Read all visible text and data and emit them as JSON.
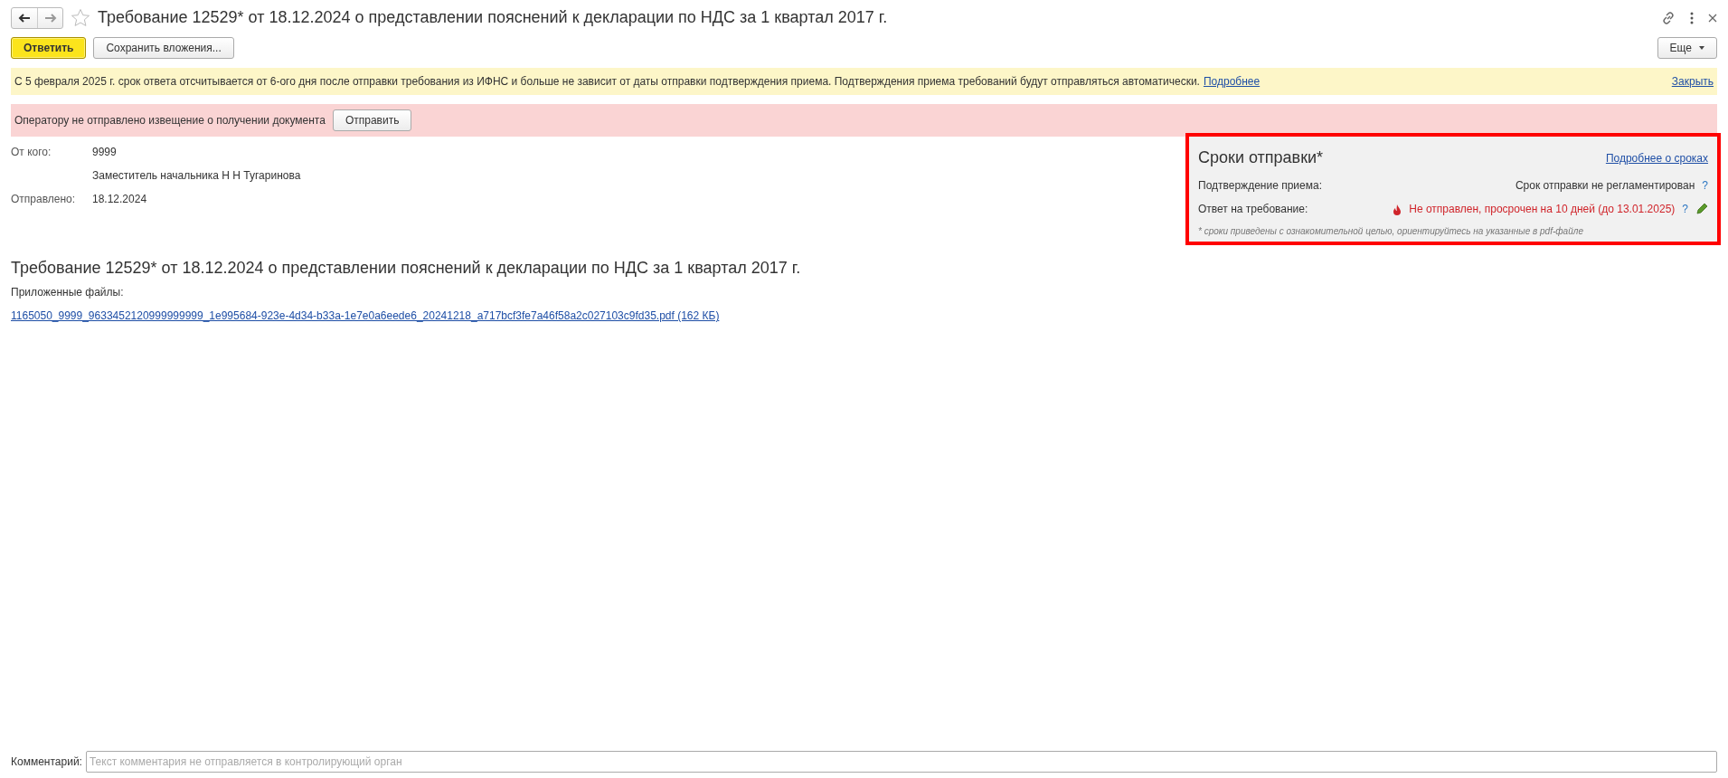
{
  "window": {
    "title": "Требование 12529* от 18.12.2024 о представлении пояснений к декларации по НДС за 1 квартал 2017 г."
  },
  "toolbar": {
    "buttons": [
      {
        "label": "Ответить",
        "kind": "default"
      },
      {
        "label": "Сохранить вложения...",
        "kind": "normal"
      }
    ],
    "more": "Еще"
  },
  "notice": {
    "text": "С 5 февраля 2025 г. срок ответа отсчитывается от 6-ого дня после отправки требования из ИФНС и больше не зависит от даты отправки подтверждения приема. Подтверждения приема требований будут отправляться автоматически.",
    "link": "Подробнее",
    "close": "Закрыть"
  },
  "alert": {
    "text": "Оператору не отправлено извещение о получении документа",
    "button": "Отправить"
  },
  "sender": {
    "from_label": "От кого:",
    "from_values": [
      "9999",
      "Заместитель начальника Н Н Тугаринова"
    ],
    "sent_label": "Отправлено:",
    "sent_value": "18.12.2024"
  },
  "deadlines": {
    "title": "Сроки отправки*",
    "link": "Подробнее о сроках",
    "highlighted": true,
    "rows": [
      {
        "label": "Подтверждение приема:",
        "value": "Срок отправки не регламентирован",
        "help": "?",
        "overdue": false
      },
      {
        "label": "Ответ на требование:",
        "value": "Не отправлен, просрочен на 10 дней (до 13.01.2025)",
        "help": "?",
        "overdue": true
      }
    ],
    "note": "* сроки приведены с ознакомительной целью, ориентируйтесь на указанные в pdf-файле"
  },
  "document": {
    "title": "Требование 12529* от 18.12.2024 о представлении пояснений к декларации по НДС за 1 квартал 2017 г.",
    "files_label": "Приложенные файлы:",
    "files": [
      "1165050_9999_9633452120999999999_1e995684-923e-4d34-b33a-1e7e0a6eede6_20241218_a717bcf3fe7a46f58a2c027103c9fd35.pdf (162 КБ)"
    ]
  },
  "comment": {
    "label": "Комментарий:",
    "placeholder": "Текст комментария не отправляется в контролирующий орган"
  }
}
